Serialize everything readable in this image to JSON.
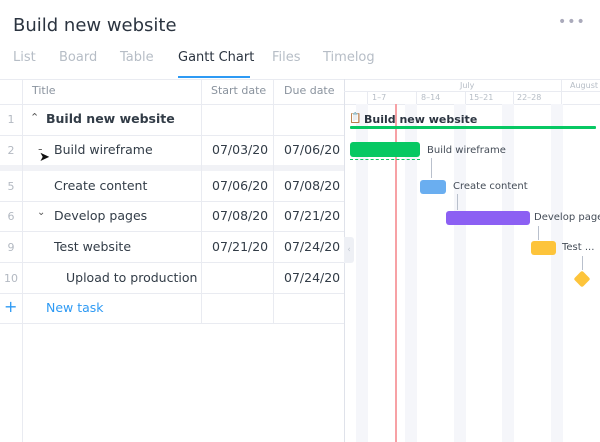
{
  "header": {
    "title": "Build new website",
    "more_icon": "more-horizontal-icon"
  },
  "tabs": [
    {
      "label": "List"
    },
    {
      "label": "Board"
    },
    {
      "label": "Table"
    },
    {
      "label": "Gantt Chart",
      "active": true
    },
    {
      "label": "Files"
    },
    {
      "label": "Timelog"
    }
  ],
  "table": {
    "columns": [
      "Title",
      "Start date",
      "Due date"
    ],
    "rows": [
      {
        "num": "1",
        "title": "Build new website",
        "start": "",
        "due": "",
        "expander": "chevron-up"
      },
      {
        "num": "2",
        "title": "Build wireframe",
        "start": "07/03/20",
        "due": "07/06/20",
        "expander": "minus"
      },
      {
        "num": "5",
        "title": "Create content",
        "start": "07/06/20",
        "due": "07/08/20"
      },
      {
        "num": "6",
        "title": "Develop pages",
        "start": "07/08/20",
        "due": "07/21/20",
        "expander": "chevron-down"
      },
      {
        "num": "9",
        "title": "Test website",
        "start": "07/21/20",
        "due": "07/24/20"
      },
      {
        "num": "10",
        "title": "Upload to production",
        "start": "",
        "due": "07/24/20"
      }
    ],
    "new_task": "New task"
  },
  "gantt": {
    "months": [
      "July",
      "August"
    ],
    "weeks": [
      "1–7",
      "8–14",
      "15–21",
      "22–28"
    ],
    "project": "Build new website",
    "tasks": [
      {
        "label": "Build wireframe",
        "color": "#07c863"
      },
      {
        "label": "Create content",
        "color": "#6aaef0"
      },
      {
        "label": "Develop pages",
        "color": "#8c60f3"
      },
      {
        "label": "Test ...",
        "color": "#fdc43b"
      }
    ],
    "milestone_color": "#fdc43b",
    "today_color": "#f7a1a5",
    "project_color": "#07c863"
  }
}
